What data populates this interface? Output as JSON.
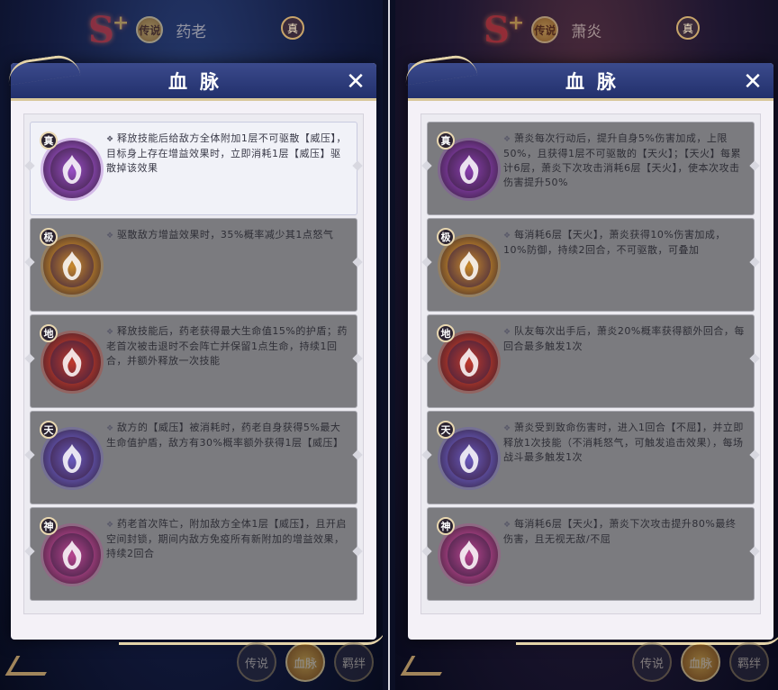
{
  "panels": [
    {
      "grade": "S",
      "grade_plus": "+",
      "legend_badge": "传说",
      "hero_name": "药老",
      "true_badge": "真",
      "dialog_title": "血脉",
      "close_label": "✕",
      "bottom_tabs": [
        "传说",
        "血脉",
        "羁绊"
      ],
      "abilities": [
        {
          "tier": "真",
          "active": true,
          "color": "#9b4fc9",
          "desc": "释放技能后给敌方全体附加1层不可驱散【威压】，目标身上存在增益效果时，立即消耗1层【威压】驱散掉该效果"
        },
        {
          "tier": "极",
          "active": false,
          "color": "#c98a2b",
          "desc": "驱散敌方增益效果时，35%概率减少其1点怒气"
        },
        {
          "tier": "地",
          "active": false,
          "color": "#c0392b",
          "desc": "释放技能后，药老获得最大生命值15%的护盾；药老首次被击退时不会阵亡并保留1点生命，持续1回合，并额外释放一次技能"
        },
        {
          "tier": "天",
          "active": false,
          "color": "#6a5bc0",
          "desc": "敌方的【威压】被消耗时，药老自身获得5%最大生命值护盾，敌方有30%概率额外获得1层【威压】"
        },
        {
          "tier": "神",
          "active": false,
          "color": "#b8458f",
          "desc": "药老首次阵亡，附加敌方全体1层【威压】，且开启空间封锁，期间内敌方免疫所有新附加的增益效果，持续2回合"
        }
      ]
    },
    {
      "grade": "S",
      "grade_plus": "+",
      "legend_badge": "传说",
      "hero_name": "萧炎",
      "true_badge": "真",
      "dialog_title": "血脉",
      "close_label": "✕",
      "bottom_tabs": [
        "传说",
        "血脉",
        "羁绊"
      ],
      "abilities": [
        {
          "tier": "真",
          "active": false,
          "color": "#8a3fb0",
          "desc": "萧炎每次行动后，提升自身5%伤害加成，上限50%，且获得1层不可驱散的【天火】；【天火】每累计6层，萧炎下次攻击消耗6层【天火】，使本次攻击伤害提升50%"
        },
        {
          "tier": "极",
          "active": false,
          "color": "#c98a2b",
          "desc": "每消耗6层【天火】，萧炎获得10%伤害加成，10%防御，持续2回合，不可驱散，可叠加"
        },
        {
          "tier": "地",
          "active": false,
          "color": "#c0392b",
          "desc": "队友每次出手后，萧炎20%概率获得额外回合，每回合最多触发1次"
        },
        {
          "tier": "天",
          "active": false,
          "color": "#6a5bc0",
          "desc": "萧炎受到致命伤害时，进入1回合【不屈】，并立即释放1次技能（不消耗怒气，可触发追击效果），每场战斗最多触发1次"
        },
        {
          "tier": "神",
          "active": false,
          "color": "#b8458f",
          "desc": "每消耗6层【天火】，萧炎下次攻击提升80%最终伤害，且无视无敌/不屈"
        }
      ]
    }
  ]
}
